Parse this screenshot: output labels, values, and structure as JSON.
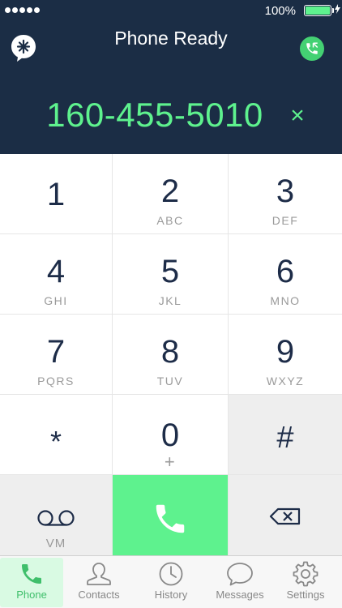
{
  "status_bar": {
    "battery_percent": "100%",
    "battery_level": 1.0
  },
  "header": {
    "title": "Phone Ready",
    "dialed_number": "160-455-5010",
    "clear_symbol": "×"
  },
  "keypad": {
    "keys": [
      {
        "digit": "1",
        "letters": ""
      },
      {
        "digit": "2",
        "letters": "ABC"
      },
      {
        "digit": "3",
        "letters": "DEF"
      },
      {
        "digit": "4",
        "letters": "GHI"
      },
      {
        "digit": "5",
        "letters": "JKL"
      },
      {
        "digit": "6",
        "letters": "MNO"
      },
      {
        "digit": "7",
        "letters": "PQRS"
      },
      {
        "digit": "8",
        "letters": "TUV"
      },
      {
        "digit": "9",
        "letters": "WXYZ"
      },
      {
        "digit": "*",
        "letters": ""
      },
      {
        "digit": "0",
        "letters": "+"
      },
      {
        "digit": "#",
        "letters": ""
      }
    ],
    "voicemail_label": "VM"
  },
  "tabs": [
    {
      "label": "Phone",
      "icon": "phone-icon",
      "active": true
    },
    {
      "label": "Contacts",
      "icon": "contacts-icon",
      "active": false
    },
    {
      "label": "History",
      "icon": "clock-icon",
      "active": false
    },
    {
      "label": "Messages",
      "icon": "speech-bubble-icon",
      "active": false
    },
    {
      "label": "Settings",
      "icon": "gear-icon",
      "active": false
    }
  ],
  "colors": {
    "header_bg": "#1b2d45",
    "accent_green": "#5ef28e",
    "call_button": "#5ef28e",
    "active_tab_bg": "#d9fae3",
    "key_text": "#1d2c48"
  }
}
